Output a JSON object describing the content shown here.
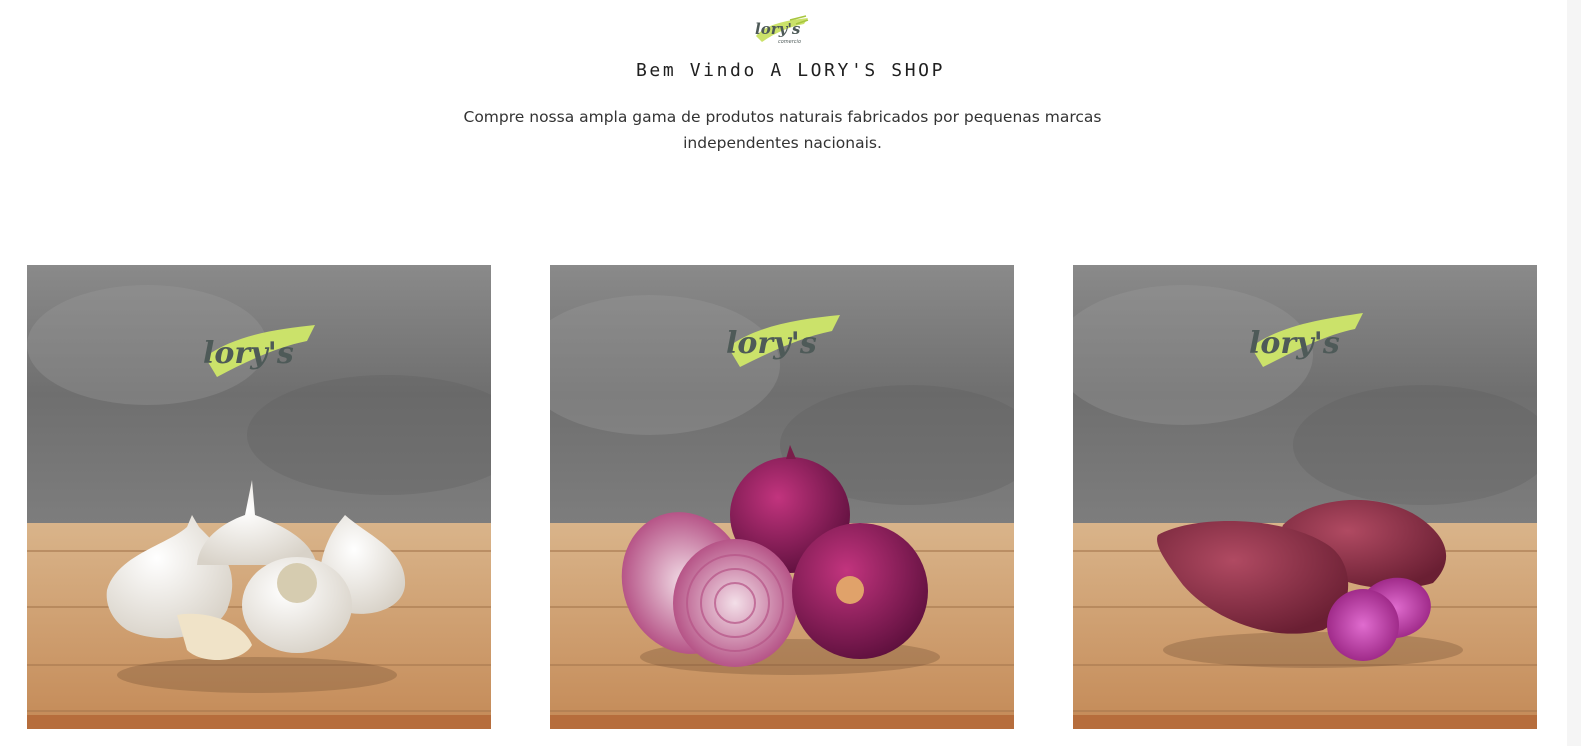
{
  "brand": {
    "logo_text": "lory's",
    "logo_subtext": "comercio",
    "accent_color": "#cbe26a"
  },
  "welcome": {
    "title": "Bem Vindo A LORY'S SHOP",
    "description": "Compre nossa ampla gama de produtos naturais fabricados por pequenas marcas independentes nacionais."
  },
  "products": [
    {
      "name": "garlic",
      "icon": "garlic-image"
    },
    {
      "name": "red-onion",
      "icon": "red-onion-image"
    },
    {
      "name": "sweet-potato",
      "icon": "sweet-potato-image"
    }
  ]
}
